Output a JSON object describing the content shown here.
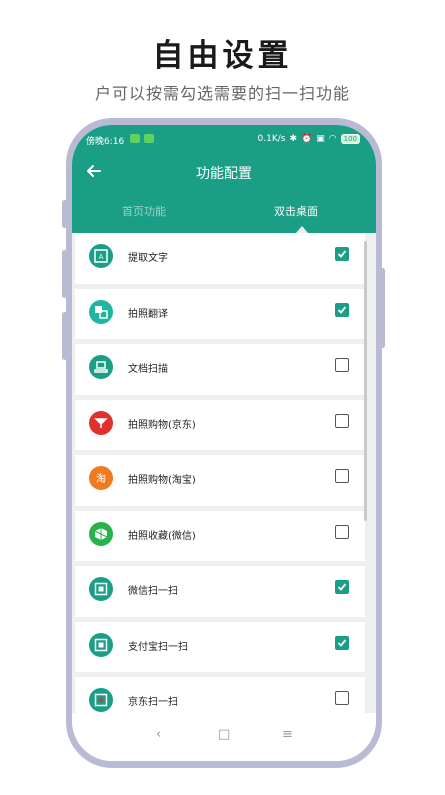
{
  "hero": {
    "title": "自由设置",
    "subtitle": "户可以按需勾选需要的扫一扫功能"
  },
  "status": {
    "time": "傍晚6:16",
    "speed": "0.1K/s",
    "battery": "100"
  },
  "nav": {
    "title": "功能配置"
  },
  "tabs": [
    {
      "label": "首页功能",
      "active": false
    },
    {
      "label": "双击桌面",
      "active": true
    }
  ],
  "items": [
    {
      "label": "提取文字",
      "checked": true,
      "icon": "extract-text-icon",
      "color": "#1a9e86"
    },
    {
      "label": "拍照翻译",
      "checked": true,
      "icon": "translate-icon",
      "color": "#1fb5a0"
    },
    {
      "label": "文档扫描",
      "checked": false,
      "icon": "document-scan-icon",
      "color": "#1a9e86"
    },
    {
      "label": "拍照购物(京东)",
      "checked": false,
      "icon": "jd-shopping-icon",
      "color": "#e0312c"
    },
    {
      "label": "拍照购物(淘宝)",
      "checked": false,
      "icon": "taobao-shopping-icon",
      "color": "#f07a1e"
    },
    {
      "label": "拍照收藏(微信)",
      "checked": false,
      "icon": "wechat-favorite-icon",
      "color": "#27b24b"
    },
    {
      "label": "微信扫一扫",
      "checked": true,
      "icon": "wechat-scan-icon",
      "color": "#1a9e86"
    },
    {
      "label": "支付宝扫一扫",
      "checked": true,
      "icon": "alipay-scan-icon",
      "color": "#1a9e86"
    },
    {
      "label": "京东扫一扫",
      "checked": false,
      "icon": "jd-scan-icon",
      "color": "#1a9e86"
    }
  ],
  "navbar": {
    "back": "‹",
    "home": "□",
    "menu": "≡"
  },
  "colors": {
    "accent": "#1a9e86",
    "phone_frame": "#b9bbd4"
  }
}
